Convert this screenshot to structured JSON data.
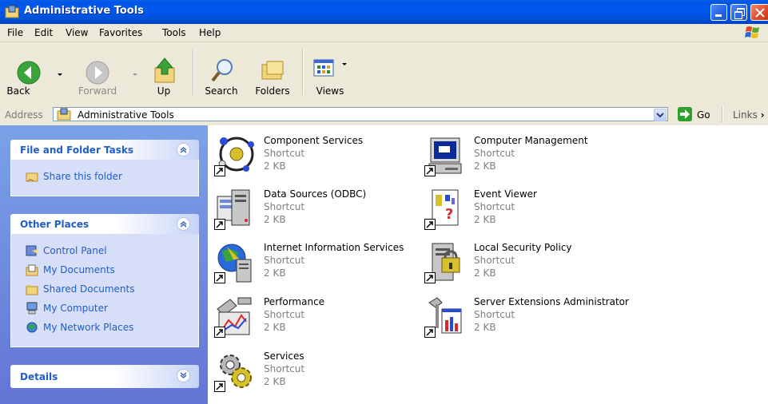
{
  "window": {
    "title": "Administrative Tools"
  },
  "menu": [
    "File",
    "Edit",
    "View",
    "Favorites",
    "Tools",
    "Help"
  ],
  "toolbar": {
    "back": "Back",
    "forward": "Forward",
    "up": "Up",
    "search": "Search",
    "folders": "Folders",
    "views": "Views"
  },
  "address": {
    "label": "Address",
    "value": "Administrative Tools",
    "go": "Go",
    "links": "Links"
  },
  "taskpane": {
    "file_tasks": {
      "title": "File and Folder Tasks",
      "items": [
        "Share this folder"
      ]
    },
    "other_places": {
      "title": "Other Places",
      "items": [
        "Control Panel",
        "My Documents",
        "Shared Documents",
        "My Computer",
        "My Network Places"
      ]
    },
    "details": {
      "title": "Details"
    }
  },
  "files": [
    {
      "name": "Component Services",
      "type": "Shortcut",
      "size": "2 KB",
      "icon": "component-services-icon"
    },
    {
      "name": "Computer Management",
      "type": "Shortcut",
      "size": "2 KB",
      "icon": "computer-management-icon"
    },
    {
      "name": "Data Sources (ODBC)",
      "type": "Shortcut",
      "size": "2 KB",
      "icon": "data-sources-icon"
    },
    {
      "name": "Event Viewer",
      "type": "Shortcut",
      "size": "2 KB",
      "icon": "event-viewer-icon"
    },
    {
      "name": "Internet Information Services",
      "type": "Shortcut",
      "size": "2 KB",
      "icon": "iis-icon"
    },
    {
      "name": "Local Security Policy",
      "type": "Shortcut",
      "size": "2 KB",
      "icon": "local-security-policy-icon"
    },
    {
      "name": "Performance",
      "type": "Shortcut",
      "size": "2 KB",
      "icon": "performance-icon"
    },
    {
      "name": "Server Extensions Administrator",
      "type": "Shortcut",
      "size": "2 KB",
      "icon": "server-extensions-icon"
    },
    {
      "name": "Services",
      "type": "Shortcut",
      "size": "2 KB",
      "icon": "services-icon"
    }
  ],
  "colors": {
    "title_bar": "#0058ee",
    "chrome": "#ece9d8",
    "task_link": "#215dc6",
    "task_pane": "#7ba2e7"
  }
}
